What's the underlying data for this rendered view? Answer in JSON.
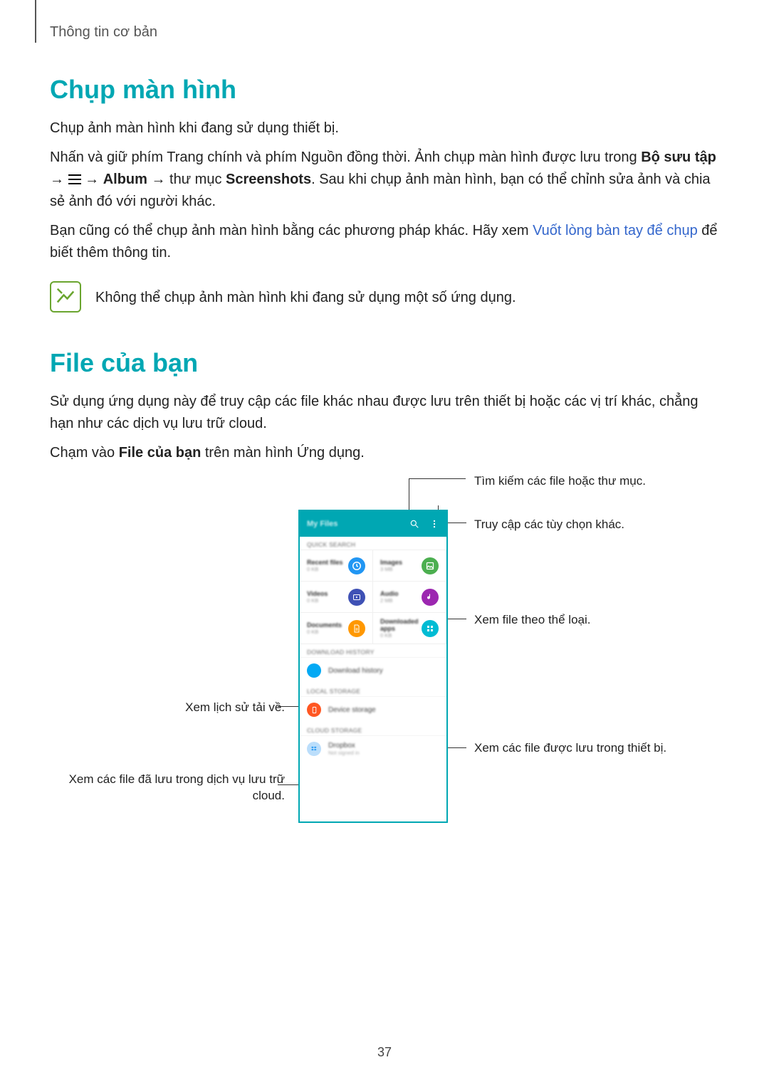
{
  "breadcrumb": "Thông tin cơ bản",
  "section1": {
    "title": "Chụp màn hình",
    "p1": "Chụp ảnh màn hình khi đang sử dụng thiết bị.",
    "p2_a": "Nhấn và giữ phím Trang chính và phím Nguồn đồng thời. Ảnh chụp màn hình được lưu trong",
    "p2_b": "Bộ sưu tập",
    "p2_c": "Album",
    "p2_d": "thư mục",
    "p2_e": "Screenshots",
    "p2_f": ". Sau khi chụp ảnh màn hình, bạn có thể chỉnh sửa ảnh và chia sẻ ảnh đó với người khác.",
    "p3_a": "Bạn cũng có thể chụp ảnh màn hình bằng các phương pháp khác. Hãy xem",
    "p3_link": "Vuốt lòng bàn tay để chụp",
    "p3_b": "để biết thêm thông tin.",
    "note": "Không thể chụp ảnh màn hình khi đang sử dụng một số ứng dụng."
  },
  "section2": {
    "title": "File của bạn",
    "p1": "Sử dụng ứng dụng này để truy cập các file khác nhau được lưu trên thiết bị hoặc các vị trí khác, chẳng hạn như các dịch vụ lưu trữ cloud.",
    "p2_a": "Chạm vào",
    "p2_b": "File của bạn",
    "p2_c": "trên màn hình Ứng dụng."
  },
  "callouts": {
    "search": "Tìm kiếm các file hoặc thư mục.",
    "more": "Truy cập các tùy chọn khác.",
    "by_type": "Xem file theo thể loại.",
    "device": "Xem các file được lưu trong thiết bị.",
    "history": "Xem lịch sử tải về.",
    "cloud": "Xem các file đã lưu trong dịch vụ lưu trữ cloud."
  },
  "phone": {
    "title": "My Files",
    "quick": "QUICK SEARCH",
    "tiles": [
      {
        "t": "Recent files",
        "s": "0 KB"
      },
      {
        "t": "Images",
        "s": "3 MB"
      },
      {
        "t": "Videos",
        "s": "0 KB"
      },
      {
        "t": "Audio",
        "s": "2 MB"
      },
      {
        "t": "Documents",
        "s": "0 KB"
      },
      {
        "t": "Downloaded apps",
        "s": "0 KB"
      }
    ],
    "dl_header": "DOWNLOAD HISTORY",
    "dl": "Download history",
    "local_header": "LOCAL STORAGE",
    "local": "Device storage",
    "cloud_header": "CLOUD STORAGE",
    "cloud": "Dropbox",
    "cloud_sub": "Not signed in"
  },
  "arrow": "→",
  "page": "37"
}
